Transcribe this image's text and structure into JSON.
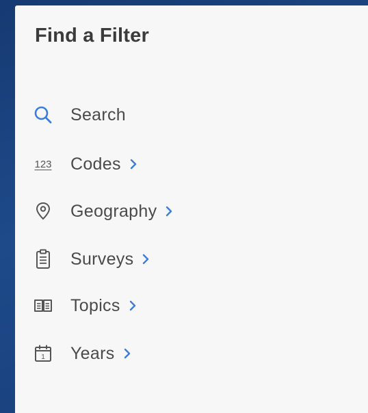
{
  "panel": {
    "title": "Find a Filter"
  },
  "menu": {
    "items": [
      {
        "label": "Search",
        "icon": "search-icon",
        "has_chevron": false
      },
      {
        "label": "Codes",
        "icon": "codes-icon",
        "has_chevron": true
      },
      {
        "label": "Geography",
        "icon": "map-pin-icon",
        "has_chevron": true
      },
      {
        "label": "Surveys",
        "icon": "clipboard-icon",
        "has_chevron": true
      },
      {
        "label": "Topics",
        "icon": "book-icon",
        "has_chevron": true
      },
      {
        "label": "Years",
        "icon": "calendar-icon",
        "has_chevron": true
      }
    ],
    "codes_glyph": "123",
    "calendar_glyph": "1"
  },
  "colors": {
    "accent": "#3b7dd8",
    "text": "#4a4a4a",
    "title": "#3b3b3b",
    "panel_bg": "#f7f7f7",
    "background": "#1e4a8a"
  }
}
